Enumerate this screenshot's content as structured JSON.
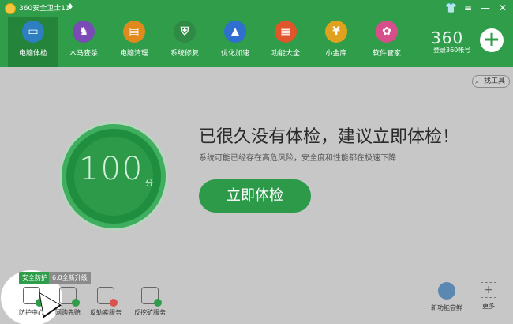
{
  "app": {
    "title": "360安全卫士11"
  },
  "window_controls": [
    "shirt-icon",
    "menu-icon",
    "minimize-icon",
    "close-icon"
  ],
  "nav": {
    "items": [
      {
        "label": "电脑体检",
        "icon": "monitor-check-icon",
        "color": "#2e7fc0",
        "active": true
      },
      {
        "label": "木马查杀",
        "icon": "horse-icon",
        "color": "#7b4bb5",
        "active": false
      },
      {
        "label": "电脑清理",
        "icon": "broom-icon",
        "color": "#e08a1e",
        "active": false
      },
      {
        "label": "系统修复",
        "icon": "shield-icon",
        "color": "#2f8a45",
        "active": false
      },
      {
        "label": "优化加速",
        "icon": "rocket-icon",
        "color": "#2e6fd0",
        "active": false
      },
      {
        "label": "功能大全",
        "icon": "grid-icon",
        "color": "#e0562a",
        "active": false
      },
      {
        "label": "小金库",
        "icon": "money-bag-icon",
        "color": "#e0a21e",
        "active": false
      },
      {
        "label": "软件管家",
        "icon": "software-icon",
        "color": "#d64e8a",
        "active": false
      }
    ]
  },
  "account": {
    "brand": "360",
    "login_label": "登录360帐号"
  },
  "main": {
    "find_tools": "找工具",
    "score": "100",
    "score_unit": "分",
    "headline": "已很久没有体检，建议立即体检！",
    "subline": "系统可能已经存在高危风险，安全度和性能都在极速下降",
    "check_button": "立即体检"
  },
  "bottom": {
    "badge_text": "安全防护",
    "badge_ext": "6.0全新升级",
    "items": [
      {
        "label": "防护中心",
        "icon": "protection-center-icon"
      },
      {
        "label": "网购先赔",
        "icon": "cart-icon"
      },
      {
        "label": "反勒索服务",
        "icon": "anti-ransom-icon"
      },
      {
        "label": "反挖矿服务",
        "icon": "anti-mining-icon"
      }
    ],
    "right_items": [
      {
        "label": "新功能尝鲜",
        "icon": "new-feature-icon"
      },
      {
        "label": "更多",
        "icon": "more-icon"
      }
    ]
  },
  "colors": {
    "brand_green": "#2f9d4a",
    "overlay_gray": "#c7c7c7"
  }
}
